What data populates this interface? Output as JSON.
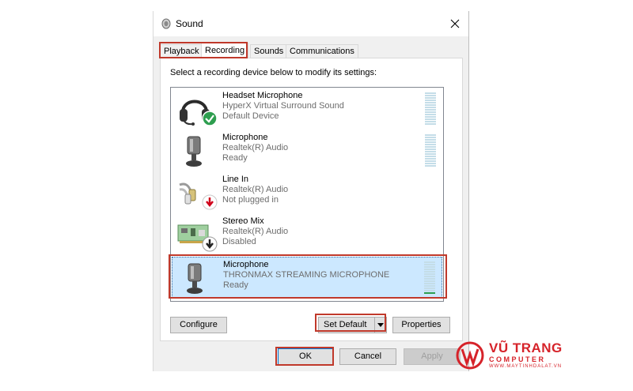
{
  "window": {
    "title": "Sound"
  },
  "tabs": [
    {
      "label": "Playback"
    },
    {
      "label": "Recording"
    },
    {
      "label": "Sounds"
    },
    {
      "label": "Communications"
    }
  ],
  "active_tab": "Recording",
  "instruction": "Select a recording device below to modify its settings:",
  "devices": [
    {
      "name": "Headset Microphone",
      "driver": "HyperX Virtual Surround Sound",
      "status": "Default Device",
      "icon": "headset-icon",
      "badge": "default-check-icon",
      "meter_level": 0
    },
    {
      "name": "Microphone",
      "driver": "Realtek(R) Audio",
      "status": "Ready",
      "icon": "microphone-icon",
      "badge": "",
      "meter_level": 0
    },
    {
      "name": "Line In",
      "driver": "Realtek(R) Audio",
      "status": "Not plugged in",
      "icon": "line-in-icon",
      "badge": "unplugged-arrow-icon",
      "meter_level": 0
    },
    {
      "name": "Stereo Mix",
      "driver": "Realtek(R) Audio",
      "status": "Disabled",
      "icon": "stereo-mix-icon",
      "badge": "disabled-arrow-icon",
      "meter_level": 0
    },
    {
      "name": "Microphone",
      "driver": "THRONMAX STREAMING MICROPHONE",
      "status": "Ready",
      "icon": "microphone-icon",
      "badge": "",
      "meter_level": 0.08,
      "selected": true
    }
  ],
  "buttons": {
    "configure": "Configure",
    "set_default": "Set Default",
    "properties": "Properties",
    "ok": "OK",
    "cancel": "Cancel",
    "apply": "Apply"
  },
  "watermark": {
    "name": "VŨ TRANG",
    "tagline": "COMPUTER",
    "url": "WWW.MAYTINHDALAT.VN"
  },
  "colors": {
    "highlight": "#c0392b",
    "selected_row": "#cce8ff",
    "meter_on": "#2e9e4f",
    "brand": "#d6232a"
  }
}
